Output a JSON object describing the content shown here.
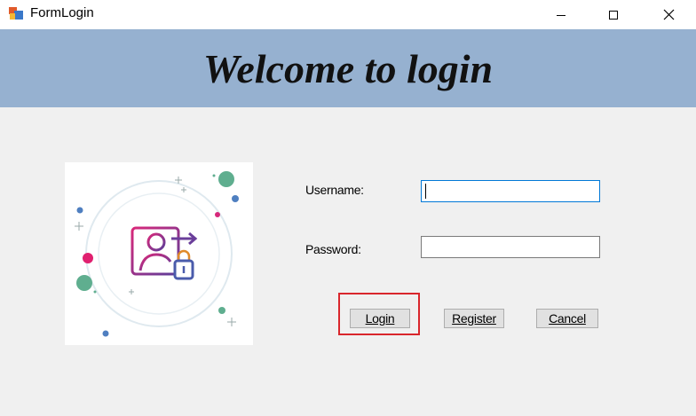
{
  "window": {
    "title": "FormLogin",
    "controls": {
      "minimize": "—",
      "maximize": "☐",
      "close": "✕"
    }
  },
  "banner": {
    "title": "Welcome to login",
    "background": "#96b1d0"
  },
  "illustration": {
    "icon": "user-lock-icon"
  },
  "form": {
    "username_label": "Username:",
    "username_value": "",
    "password_label": "Password:",
    "password_value": ""
  },
  "buttons": {
    "login": "Login",
    "register": "Register",
    "cancel": "Cancel"
  },
  "highlight_color": "#d9262c"
}
